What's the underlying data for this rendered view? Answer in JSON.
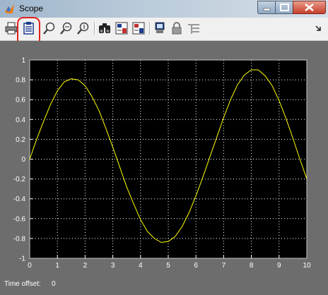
{
  "window": {
    "title": "Scope"
  },
  "toolbar": {
    "buttons": [
      {
        "name": "print-icon"
      },
      {
        "name": "parameters-icon"
      },
      {
        "name": "zoom-icon"
      },
      {
        "name": "zoom-x-icon"
      },
      {
        "name": "zoom-y-icon"
      },
      {
        "name": "autoscale-icon"
      },
      {
        "name": "save-axes-settings-icon"
      },
      {
        "name": "restore-axes-settings-icon"
      },
      {
        "name": "floating-scope-icon"
      },
      {
        "name": "lock-axes-icon"
      },
      {
        "name": "signal-selection-icon"
      },
      {
        "name": "toolbar-menu-arrow-icon"
      }
    ]
  },
  "status": {
    "label": "Time offset:",
    "value": "0"
  },
  "colors": {
    "background": "#6d6d6d",
    "plot_bg": "#000000",
    "line": "#ffff00",
    "grid": "#ffffff",
    "highlight": "#e2211c"
  },
  "chart_data": {
    "type": "line",
    "title": "",
    "xlabel": "",
    "ylabel": "",
    "xlim": [
      0,
      10
    ],
    "ylim": [
      -1,
      1
    ],
    "xticks": [
      "0",
      "1",
      "2",
      "3",
      "4",
      "5",
      "6",
      "7",
      "8",
      "9",
      "10"
    ],
    "yticks": [
      "1",
      "0.8",
      "0.6",
      "0.4",
      "0.2",
      "0",
      "-0.2",
      "-0.4",
      "-0.6",
      "-0.8",
      "-1"
    ],
    "grid": true,
    "series": [
      {
        "x": [
          0,
          0.25,
          0.5,
          0.75,
          1,
          1.25,
          1.5,
          1.75,
          2,
          2.25,
          2.5,
          2.75,
          3,
          3.25,
          3.5,
          3.75,
          4,
          4.25,
          4.5,
          4.75,
          5,
          5.25,
          5.5,
          5.75,
          6,
          6.25,
          6.5,
          6.75,
          7,
          7.25,
          7.5,
          7.75,
          8,
          8.25,
          8.5,
          8.75,
          9,
          9.25,
          9.5,
          9.75,
          10
        ],
        "y": [
          0,
          0.2,
          0.38,
          0.55,
          0.69,
          0.78,
          0.81,
          0.8,
          0.74,
          0.63,
          0.49,
          0.31,
          0.12,
          -0.08,
          -0.28,
          -0.45,
          -0.61,
          -0.73,
          -0.8,
          -0.84,
          -0.83,
          -0.78,
          -0.68,
          -0.54,
          -0.37,
          -0.18,
          0.02,
          0.22,
          0.42,
          0.6,
          0.75,
          0.85,
          0.9,
          0.9,
          0.84,
          0.74,
          0.59,
          0.41,
          0.21,
          0.0,
          -0.2
        ]
      }
    ]
  }
}
